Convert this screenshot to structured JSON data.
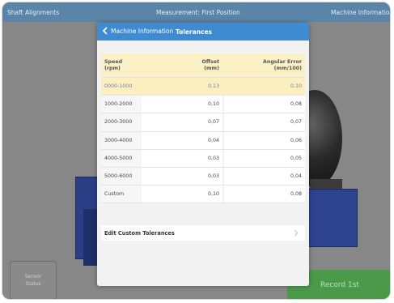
{
  "topbar": {
    "left": "Shaft Alignments",
    "center": "Measurement: First Position",
    "right": "Machine Information"
  },
  "modal": {
    "back_label": "Machine Information",
    "title": "Tolerances",
    "headers": {
      "speed": "Speed\n(rpm)",
      "offset": "Offset\n(mm)",
      "angular": "Angular Error\n(mm/100)"
    },
    "rows": [
      {
        "speed": "0000-1000",
        "offset": "0,13",
        "angular": "0,10"
      },
      {
        "speed": "1000-2000",
        "offset": "0,10",
        "angular": "0,08"
      },
      {
        "speed": "2000-3000",
        "offset": "0,07",
        "angular": "0,07"
      },
      {
        "speed": "3000-4000",
        "offset": "0,04",
        "angular": "0,06"
      },
      {
        "speed": "4000-5000",
        "offset": "0,03",
        "angular": "0,05"
      },
      {
        "speed": "5000-6000",
        "offset": "0,03",
        "angular": "0,04"
      },
      {
        "speed": "Custom",
        "offset": "0,10",
        "angular": "0,08"
      }
    ],
    "edit_label": "Edit Custom Tolerances"
  },
  "footer": {
    "sensor_status": "Sensor\nStatus",
    "record": "Record 1st"
  },
  "colors": {
    "accent": "#3e8bd1",
    "selected_row": "#fcefbf",
    "record_button": "#4a9a4a"
  }
}
